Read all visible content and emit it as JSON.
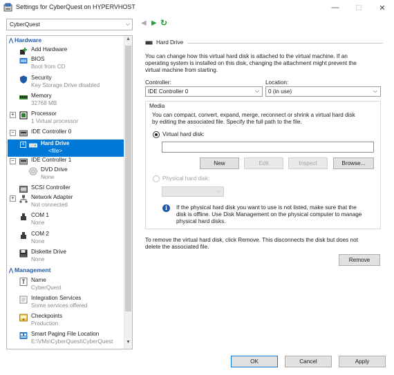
{
  "window": {
    "title": "Settings for CyberQuest on HYPERVHOST",
    "minimize_glyph": "—",
    "maximize_glyph": "☐",
    "close_glyph": "✕"
  },
  "vm_selector": {
    "value": "CyberQuest",
    "chevron": "⌵"
  },
  "tree": {
    "hardware_header": "Hardware",
    "management_header": "Management",
    "collapse_glyph": "⌃",
    "items": {
      "add_hardware": {
        "label": "Add Hardware"
      },
      "bios": {
        "label": "BIOS",
        "sub": "Boot from CD"
      },
      "security": {
        "label": "Security",
        "sub": "Key Storage Drive disabled"
      },
      "memory": {
        "label": "Memory",
        "sub": "32768 MB"
      },
      "processor": {
        "label": "Processor",
        "sub": "1 Virtual processor"
      },
      "ide0": {
        "label": "IDE Controller 0"
      },
      "hard_drive": {
        "label": "Hard Drive",
        "sub": "<file>"
      },
      "ide1": {
        "label": "IDE Controller 1"
      },
      "dvd": {
        "label": "DVD Drive",
        "sub": "None"
      },
      "scsi": {
        "label": "SCSI Controller"
      },
      "network": {
        "label": "Network Adapter",
        "sub": "Not connected"
      },
      "com1": {
        "label": "COM 1",
        "sub": "None"
      },
      "com2": {
        "label": "COM 2",
        "sub": "None"
      },
      "diskette": {
        "label": "Diskette Drive",
        "sub": "None"
      },
      "name": {
        "label": "Name",
        "sub": "CyberQuest"
      },
      "integration": {
        "label": "Integration Services",
        "sub": "Some services offered"
      },
      "checkpoints": {
        "label": "Checkpoints",
        "sub": "Production"
      },
      "paging": {
        "label": "Smart Paging File Location",
        "sub": "E:\\VMs\\CyberQuest\\CyberQuest"
      }
    }
  },
  "nav": {
    "back": "◀",
    "forward": "▶",
    "refresh": "↻"
  },
  "panel": {
    "header": "Hard Drive",
    "intro": [
      "You can change how this virtual hard disk is attached to the virtual machine. If an",
      "operating system is installed on this disk, changing the attachment might prevent the",
      "virtual machine from starting."
    ],
    "controller_label": "Controller:",
    "controller_value": "IDE Controller 0",
    "location_label": "Location:",
    "location_value": "0 (in use)",
    "media_label": "Media",
    "media_desc": [
      "You can compact, convert, expand, merge, reconnect or shrink a virtual hard disk",
      "by editing the associated file. Specify the full path to the file."
    ],
    "virtual_hd_label": "Virtual hard disk:",
    "virtual_hd_value": "",
    "btn_new": "New",
    "btn_edit": "Edit",
    "btn_inspect": "Inspect",
    "btn_browse": "Browse...",
    "physical_hd_label": "Physical hard disk:",
    "info_glyph": "i",
    "info_text": [
      "If the physical hard disk you want to use is not listed, make sure that the",
      "disk is offline. Use Disk Management on the physical computer to manage",
      "physical hard disks."
    ],
    "remove_text": [
      "To remove the virtual hard disk, click Remove. This disconnects the disk but does not",
      "delete the associated file."
    ],
    "btn_remove": "Remove"
  },
  "footer": {
    "ok": "OK",
    "cancel": "Cancel",
    "apply": "Apply"
  },
  "colors": {
    "accent": "#0078d7",
    "header_blue": "#1f58a6",
    "refresh_green": "#1f8f2a"
  }
}
